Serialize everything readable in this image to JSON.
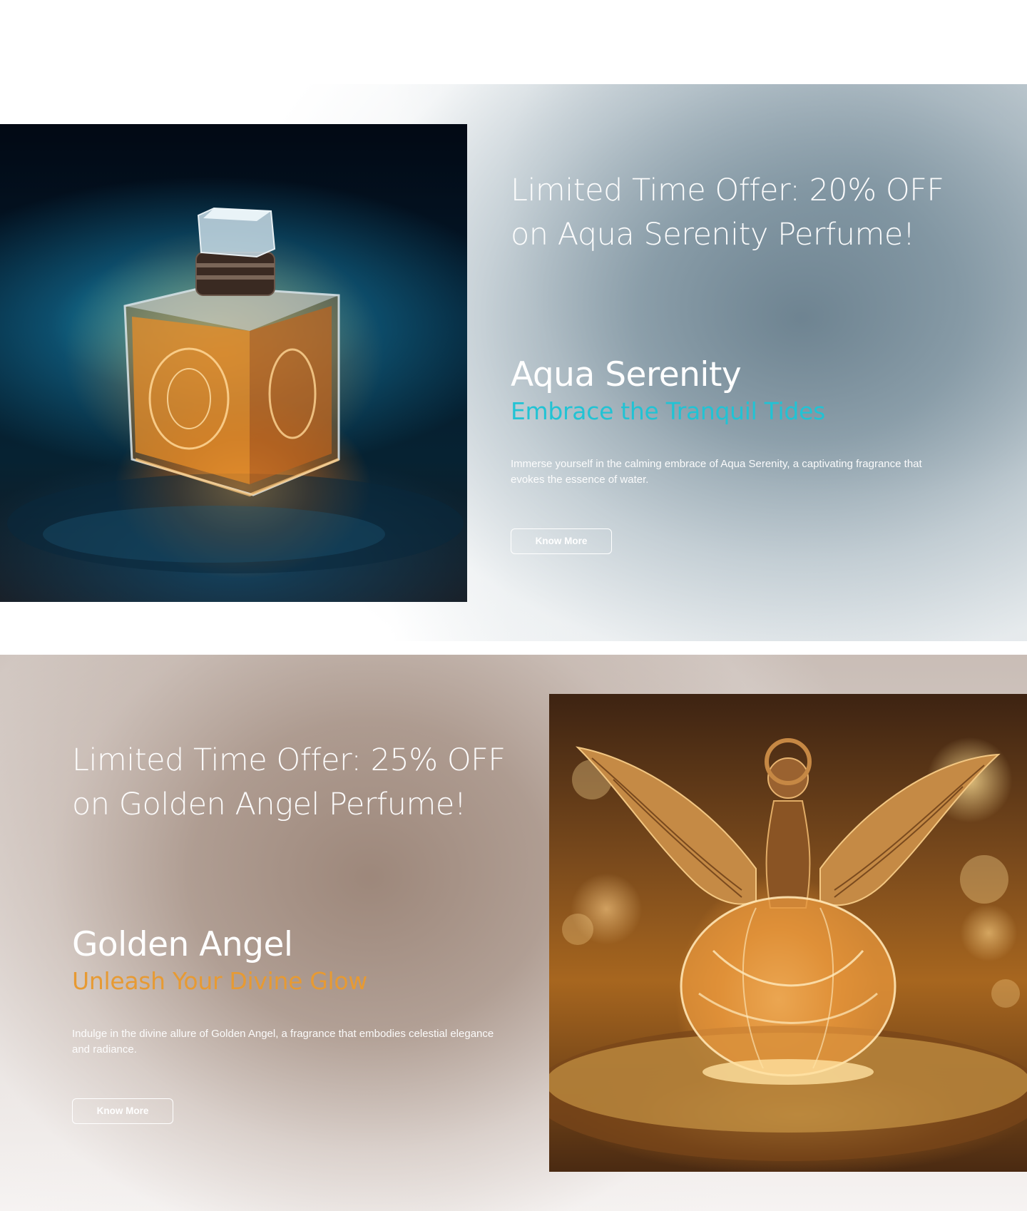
{
  "promos": [
    {
      "offer_line1": "Limited Time Offer: 20% OFF",
      "offer_line2": "on Aqua Serenity Perfume!",
      "product_name": "Aqua Serenity",
      "tagline": "Embrace the Tranquil Tides",
      "description": "Immerse yourself in the calming embrace of Aqua Serenity, a captivating fragrance that evokes the essence of water.",
      "button_label": "Know More",
      "accent_color": "#21c3d4"
    },
    {
      "offer_line1": "Limited Time Offer: 25% OFF",
      "offer_line2": "on Golden Angel Perfume!",
      "product_name": "Golden Angel",
      "tagline": "Unleash Your Divine Glow",
      "description": "Indulge in the divine allure of Golden Angel, a fragrance that embodies celestial elegance and radiance.",
      "button_label": "Know More",
      "accent_color": "#e79a33"
    }
  ]
}
